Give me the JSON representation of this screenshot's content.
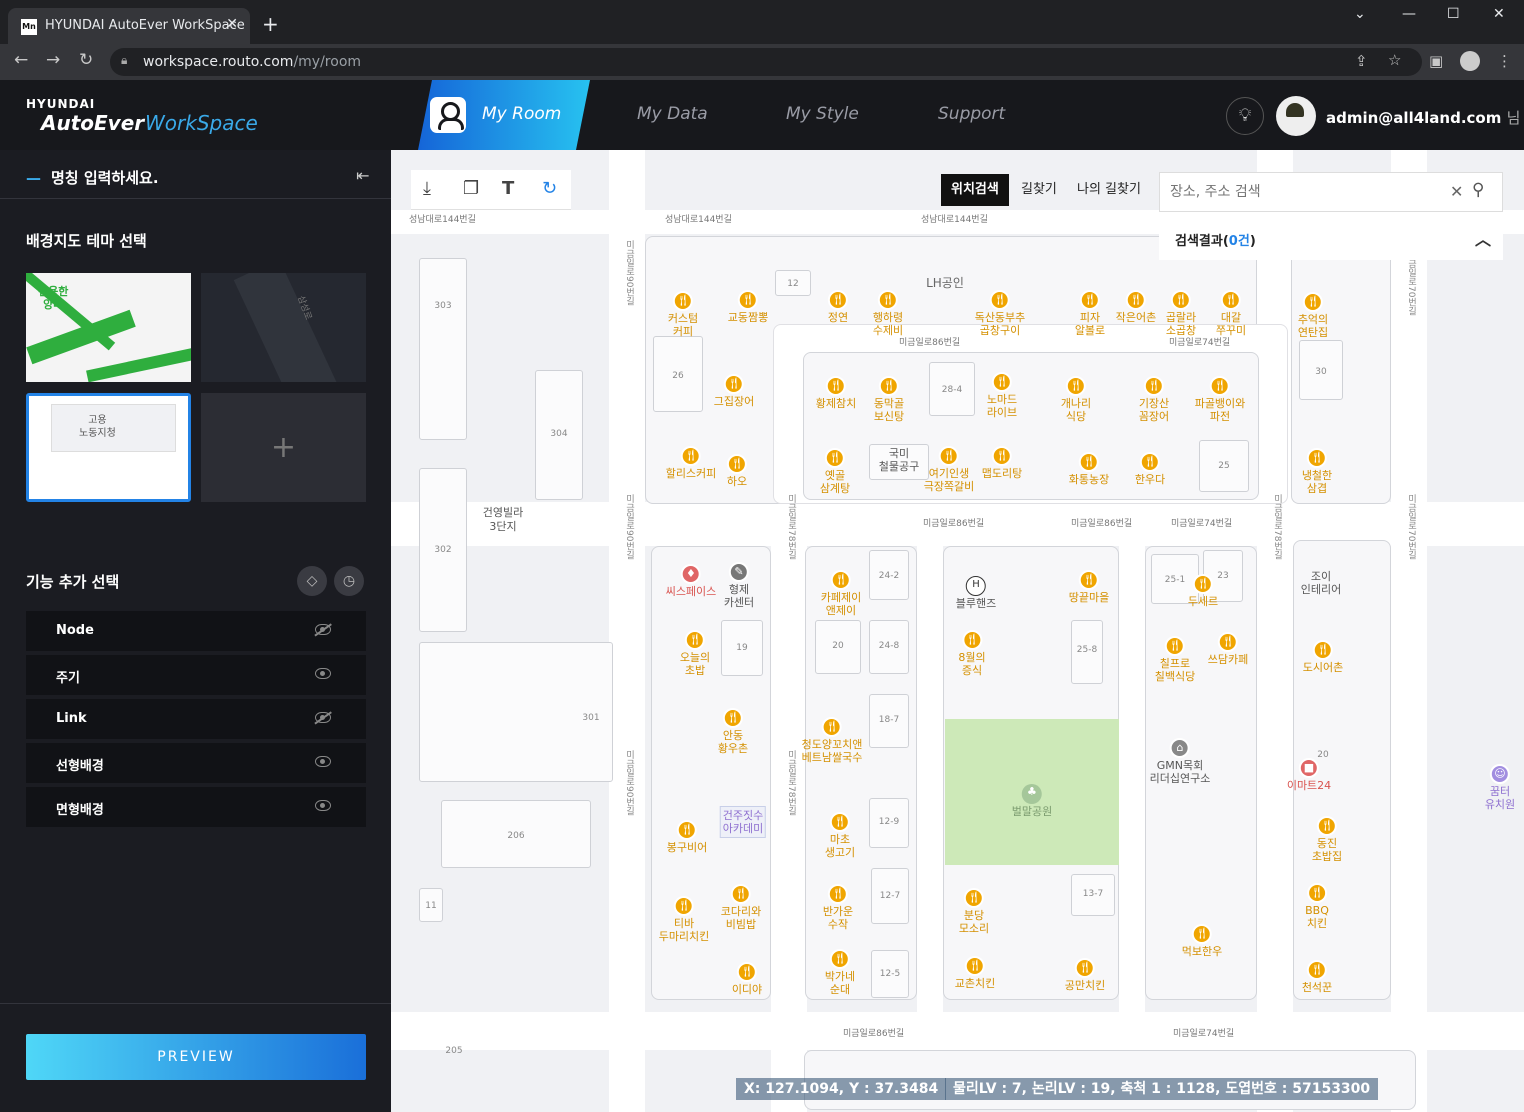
{
  "browser": {
    "tab_title": "HYUNDAI AutoEver WorkSpace",
    "favicon_text": "Mn",
    "url_host": "workspace.routo.com",
    "url_path": "/my/room"
  },
  "header": {
    "logo_line1": "HYUNDAI",
    "logo_line2": "AutoEver",
    "logo_line3": "WorkSpace",
    "nav": [
      "My Room",
      "My Data",
      "My Style",
      "Support"
    ],
    "user_email": "admin@all4land.com",
    "user_suffix": "님"
  },
  "sidebar": {
    "name_placeholder": "명칭 입력하세요.",
    "theme_heading": "배경지도 테마 선택",
    "theme_thumbs": {
      "t1_label": "진용한\n양마",
      "t2_label": "삼성로",
      "t3_label": "고용\n노동지청"
    },
    "feature_heading": "기능 추가 선택",
    "layers": [
      {
        "label": "Node",
        "visible": false
      },
      {
        "label": "주기",
        "visible": true
      },
      {
        "label": "Link",
        "visible": false
      },
      {
        "label": "선형배경",
        "visible": true
      },
      {
        "label": "면형배경",
        "visible": true
      }
    ],
    "preview_label": "PREVIEW"
  },
  "map": {
    "search_tabs": [
      "위치검색",
      "길찾기",
      "나의 길찾기"
    ],
    "search_placeholder": "장소, 주소 검색",
    "result_label": "검색결과(",
    "result_count": "0건",
    "result_close": ")",
    "status_coords": "X: 127.1094, Y : 37.3484",
    "status_levels": "물리LV : 7, 논리LV : 19, 축척 1 : 1128, 도엽번호 : 57153300",
    "road_labels": [
      "성남대로144번길",
      "성남대로144번길",
      "성남대로144번길",
      "미금일로86번길",
      "미금일로74번길",
      "미금일로86번길",
      "미금일로86번길",
      "미금일로74번길",
      "미금일로86번길",
      "미금일로74번길"
    ],
    "vertical_labels": [
      "미금일로90번길",
      "미금일로90번길",
      "미금일로90번길",
      "미금일로78번길",
      "미금일로78번길",
      "미금일로78번길",
      "미금일로70번길",
      "미금일로70번길"
    ],
    "building_labels": [
      "303",
      "304",
      "302",
      "301",
      "206",
      "11",
      "205",
      "건영빌라\n3단지",
      "LH공인",
      "국미\n철물공구",
      "조이\n인테리어",
      "12",
      "26",
      "28-4",
      "24-2",
      "20",
      "24-8",
      "19",
      "18-7",
      "12-9",
      "12-7",
      "12-5",
      "13-7",
      "25-1",
      "25-8",
      "23",
      "30",
      "25",
      "20"
    ],
    "pois": [
      "커스텀\n커피",
      "교동짬뽕",
      "정연",
      "행하령\n수제비",
      "독산동부추\n곱창구이",
      "피자\n알볼로",
      "작은어촌",
      "곱랄라\n소곱창",
      "대갈\n쭈꾸미",
      "추억의\n연탄집",
      "그집장어",
      "황제참치",
      "동막골\n보신탕",
      "노마드\n라이브",
      "개나리\n식당",
      "기장산\n꼼장어",
      "파골뱅이와\n파전",
      "할리스커피",
      "하오",
      "옛골\n삼계탕",
      "여기인생\n극장쪽갈비",
      "맵도리탕",
      "화통농장",
      "한우다",
      "냉철한\n삼겹",
      "카페제이\n앤제이",
      "땅끝마을",
      "두세르",
      "오늘의\n초밥",
      "8월의\n증식",
      "칠프로\n칠백식당",
      "쓰담카페",
      "도시어촌",
      "안동\n황우촌",
      "청도양꼬치앤\n베트남쌀국수",
      "마초\n생고기",
      "동진\n초밥집",
      "봉구비어",
      "티바\n두마리치킨",
      "코다리와\n비빔밥",
      "반가운\n수작",
      "분당\n모소리",
      "먹보한우",
      "BBQ\n치킨",
      "이디야",
      "박가네\n순대",
      "교촌치킨",
      "공만치킨",
      "천석꾼"
    ],
    "special_pois": {
      "fitness": "씨스페이스",
      "repair": "형제\n카센터",
      "hyundai": "블루핸즈",
      "research": "GMN목회\n리더십연구소",
      "mart": "이마트24",
      "academy": "건주짓수\n아카데미",
      "park": "벌말공원",
      "kinder": "꿈터\n유치원"
    }
  }
}
